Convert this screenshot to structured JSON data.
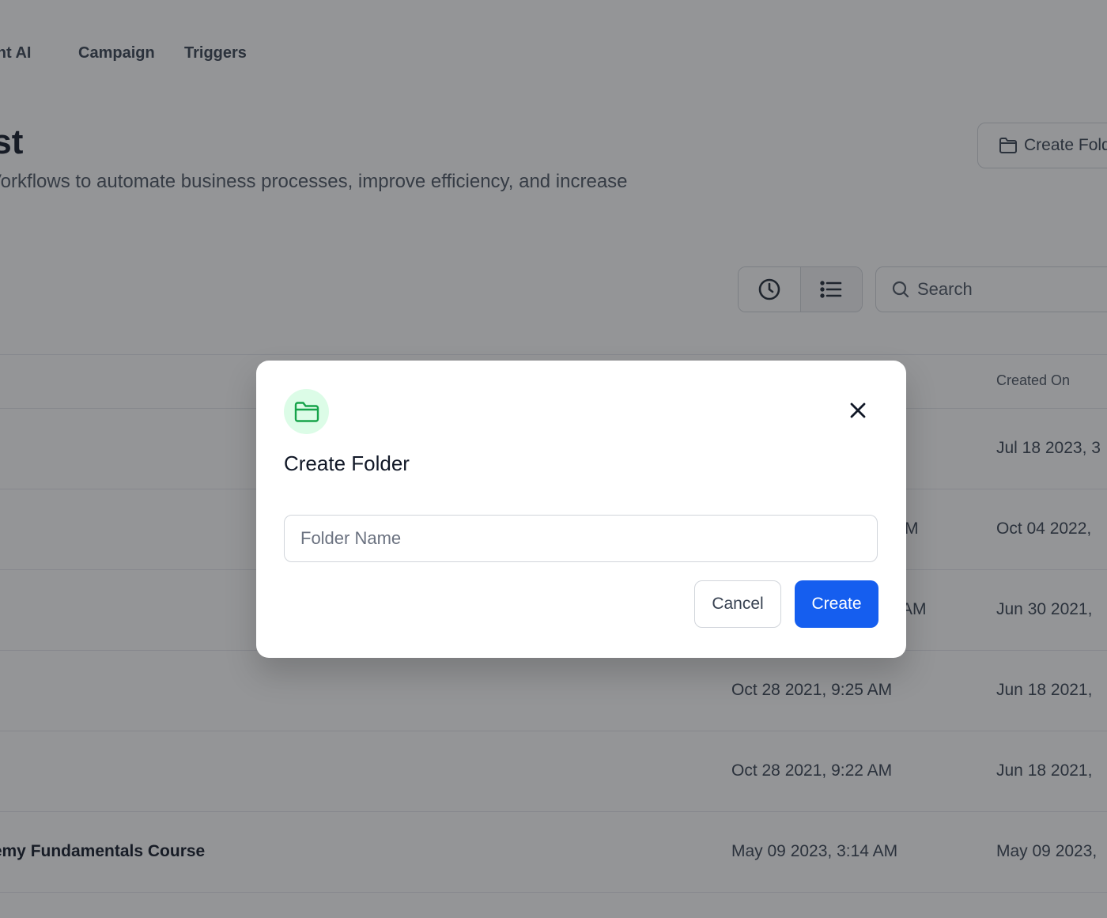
{
  "nav": {
    "items": [
      {
        "label": "tent AI"
      },
      {
        "label": "Campaign"
      },
      {
        "label": "Triggers"
      }
    ]
  },
  "header": {
    "title": "ist",
    "subtitle": "Vorkflows to automate business processes, improve efficiency, and increase",
    "create_folder_label": "Create Fold"
  },
  "toolbar": {
    "view_modes": [
      {
        "icon": "clock-icon",
        "name": "history"
      },
      {
        "icon": "list-icon",
        "name": "list"
      }
    ],
    "search": {
      "placeholder": "Search",
      "value": ""
    }
  },
  "table": {
    "columns": [
      "",
      "",
      "Created On"
    ],
    "rows": [
      {
        "name": "",
        "updated": "",
        "created": "Jul 18 2023, 3"
      },
      {
        "name": "",
        "updated": "M",
        "created": "Oct 04 2022,"
      },
      {
        "name": "",
        "updated": "AM",
        "created": "Jun 30 2021,"
      },
      {
        "name": "",
        "updated": "Oct 28 2021, 9:25 AM",
        "created": "Jun 18 2021,"
      },
      {
        "name": "",
        "updated": "Oct 28 2021, 9:22 AM",
        "created": "Jun 18 2021,"
      },
      {
        "name": "demy Fundamentals Course",
        "updated": "May 09 2023, 3:14 AM",
        "created": "May 09 2023,"
      }
    ]
  },
  "modal": {
    "icon": "folder-icon",
    "title": "Create Folder",
    "input": {
      "placeholder": "Folder Name",
      "value": ""
    },
    "cancel_label": "Cancel",
    "create_label": "Create",
    "colors": {
      "primary": "#155eef",
      "icon_bg": "#dcfce7",
      "icon_stroke": "#16a34a"
    }
  }
}
